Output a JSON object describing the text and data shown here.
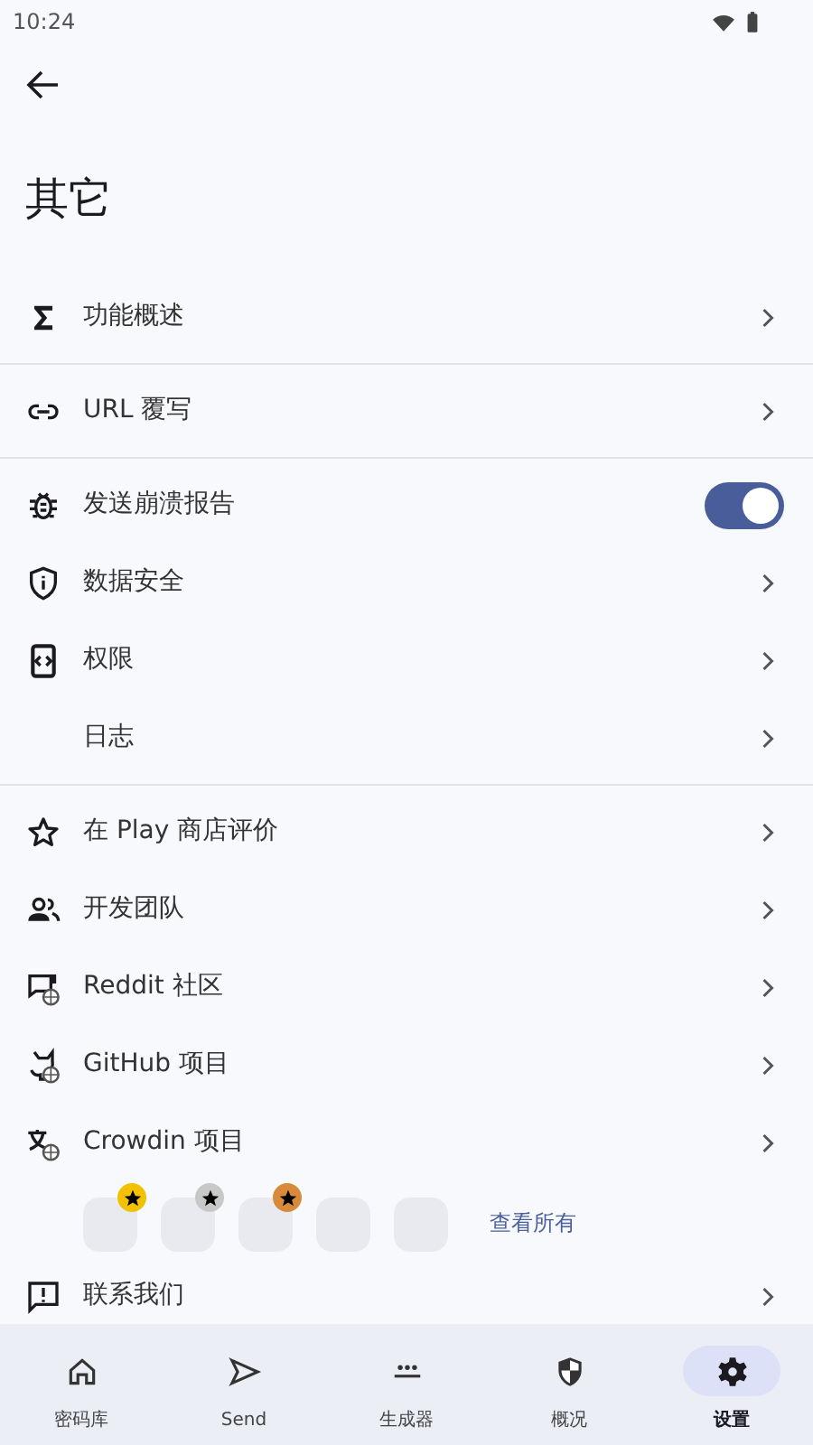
{
  "status_bar": {
    "time": "10:24"
  },
  "title": "其它",
  "groups": [
    [
      {
        "kind": "link",
        "label": "功能概述"
      }
    ],
    [
      {
        "kind": "link",
        "label": "URL 覆写"
      }
    ],
    [
      {
        "kind": "toggle",
        "label": "发送崩溃报告",
        "on": true
      },
      {
        "kind": "link",
        "label": "数据安全"
      },
      {
        "kind": "link",
        "label": "权限"
      },
      {
        "kind": "link",
        "label": "日志"
      }
    ],
    [
      {
        "kind": "link",
        "label": "在 Play 商店评价"
      },
      {
        "kind": "link",
        "label": "开发团队"
      },
      {
        "kind": "link",
        "label": "Reddit 社区"
      },
      {
        "kind": "link",
        "label": "GitHub 项目"
      },
      {
        "kind": "link",
        "label": "Crowdin 项目"
      },
      {
        "kind": "contributors",
        "avatars": [
          {
            "badge": true,
            "color": "#f2c200"
          },
          {
            "badge": true,
            "color": "#c8c8c8"
          },
          {
            "badge": true,
            "color": "#d9893a"
          },
          {
            "badge": false
          },
          {
            "badge": false
          }
        ],
        "link": "查看所有"
      },
      {
        "kind": "link",
        "label": "联系我们"
      }
    ]
  ],
  "nav": [
    {
      "label": "密码库",
      "selected": false
    },
    {
      "label": "Send",
      "selected": false
    },
    {
      "label": "生成器",
      "selected": false
    },
    {
      "label": "概况",
      "selected": false
    },
    {
      "label": "设置",
      "selected": true
    }
  ]
}
